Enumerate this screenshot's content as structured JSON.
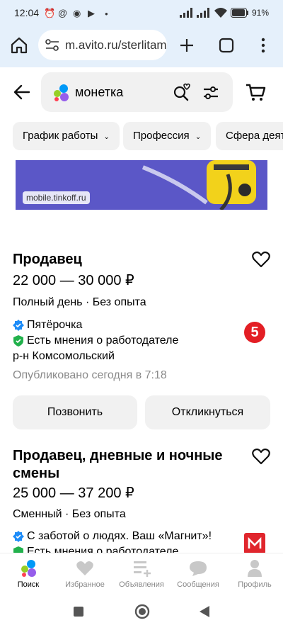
{
  "status_bar": {
    "time": "12:04",
    "battery_percent": "91"
  },
  "browser": {
    "url": "m.avito.ru/sterlitamak/vakansii"
  },
  "search": {
    "query": "монетка"
  },
  "filters": [
    {
      "label": "График работы"
    },
    {
      "label": "Профессия"
    },
    {
      "label": "Сфера деят"
    }
  ],
  "banner": {
    "site": "mobile.tinkoff.ru"
  },
  "listings": [
    {
      "title": "Продавец",
      "price": "22 000 — 30 000 ₽",
      "conditions": "Полный день · Без опыта",
      "employer": "Пятёрочка",
      "reviews": "Есть мнения о работодателе",
      "district": "р-н Комсомольский",
      "published": "Опубликовано сегодня в 7:18",
      "logo_text": "5",
      "call_label": "Позвонить",
      "respond_label": "Откликнуться"
    },
    {
      "title_line1": "Продавец, дневные и ночные",
      "title_line2": "смены",
      "price": "25 000 — 37 200 ₽",
      "conditions": "Сменный · Без опыта",
      "employer": "С заботой о людях. Ваш «Магнит»!",
      "reviews": "Есть мнения о работодателе"
    }
  ],
  "bottom_nav": [
    {
      "label": "Поиск"
    },
    {
      "label": "Избранное"
    },
    {
      "label": "Объявления"
    },
    {
      "label": "Сообщения"
    },
    {
      "label": "Профиль"
    }
  ],
  "colors": {
    "accent_blue": "#0099f7",
    "verified_blue": "#1d8cf8",
    "verified_green": "#22b14c",
    "banner": "#5b57c7",
    "magnit_red": "#e0262d",
    "pyaterochka_red": "#e31e24"
  }
}
